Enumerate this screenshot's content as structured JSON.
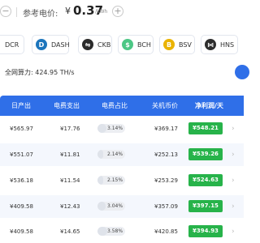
{
  "price": {
    "label": "参考电价:",
    "currency": "¥",
    "value": "0.37",
    "unit": "/kWh",
    "minus": "−",
    "plus": "+"
  },
  "coins": [
    {
      "name": "DCR",
      "icon": "dcr-icon",
      "symbol": "",
      "color": ""
    },
    {
      "name": "DASH",
      "icon": "dash-icon",
      "symbol": "D",
      "color": "#1c75bc"
    },
    {
      "name": "CKB",
      "icon": "ckb-icon",
      "symbol": "⇋",
      "color": "#2b2b2b"
    },
    {
      "name": "BCH",
      "icon": "bch-icon",
      "symbol": "$",
      "color": "#4cc785"
    },
    {
      "name": "BSV",
      "icon": "bsv-icon",
      "symbol": "B",
      "color": "#eab300"
    },
    {
      "name": "HNS",
      "icon": "hns-icon",
      "symbol": "⋈",
      "color": "#2d2d2d"
    }
  ],
  "hashrate": {
    "text": "全网算力: 424.95 TH/s"
  },
  "table": {
    "headers": [
      "日产出",
      "电费支出",
      "电费占比",
      "关机币价",
      "净利润/天"
    ],
    "rows": [
      {
        "output": "¥565.97",
        "cost": "¥17.76",
        "ratio": "3.14%",
        "ratio_value": 3.14,
        "shutdown": "¥369.17",
        "profit": "¥548.21"
      },
      {
        "output": "¥551.07",
        "cost": "¥11.81",
        "ratio": "2.14%",
        "ratio_value": 2.14,
        "shutdown": "¥252.13",
        "profit": "¥539.26"
      },
      {
        "output": "¥536.18",
        "cost": "¥11.54",
        "ratio": "2.15%",
        "ratio_value": 2.15,
        "shutdown": "¥253.29",
        "profit": "¥524.63"
      },
      {
        "output": "¥409.58",
        "cost": "¥12.43",
        "ratio": "3.04%",
        "ratio_value": 3.04,
        "shutdown": "¥357.09",
        "profit": "¥397.15"
      },
      {
        "output": "¥409.58",
        "cost": "¥14.65",
        "ratio": "3.58%",
        "ratio_value": 3.58,
        "shutdown": "¥420.85",
        "profit": "¥394.93"
      }
    ]
  },
  "colors": {
    "accent": "#2f6fe8",
    "profit": "#27b34a"
  }
}
